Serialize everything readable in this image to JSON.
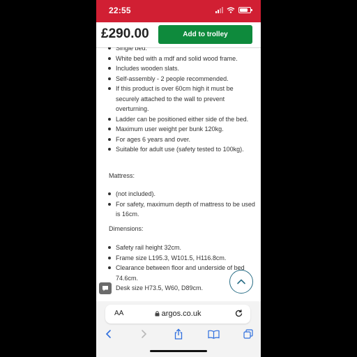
{
  "status_bar": {
    "time": "22:55"
  },
  "price_bar": {
    "price": "£290.00",
    "add_button": "Add to trolley"
  },
  "features": [
    "Single bed.",
    "White bed with a mdf and solid wood frame.",
    "Includes wooden slats.",
    "Self-assembly - 2 people recommended.",
    "If this product is over 60cm high it must be securely attached to the wall to prevent overturning.",
    "Ladder can be positioned either side of the bed.",
    "Maximum user weight per bunk 120kg.",
    "For ages 6 years and over.",
    "Suitable for adult use (safety tested to 100kg)."
  ],
  "mattress": {
    "heading": "Mattress:",
    "items": [
      "(not included).",
      "For safety, maximum depth of mattress to be used is 16cm."
    ]
  },
  "dimensions": {
    "heading": "Dimensions:",
    "items": [
      "Safety rail height 32cm.",
      "Frame size L195.3, W101.5, H116.8cm.",
      "Clearance between floor and underside of bed 74.6cm.",
      "Desk size H73.5, W60, D89cm."
    ]
  },
  "browser": {
    "aa_label": "AA",
    "url": "argos.co.uk"
  },
  "colors": {
    "brand_red": "#d11f33",
    "trolley_green": "#0e8a3c",
    "link_blue": "#2a6e86"
  }
}
